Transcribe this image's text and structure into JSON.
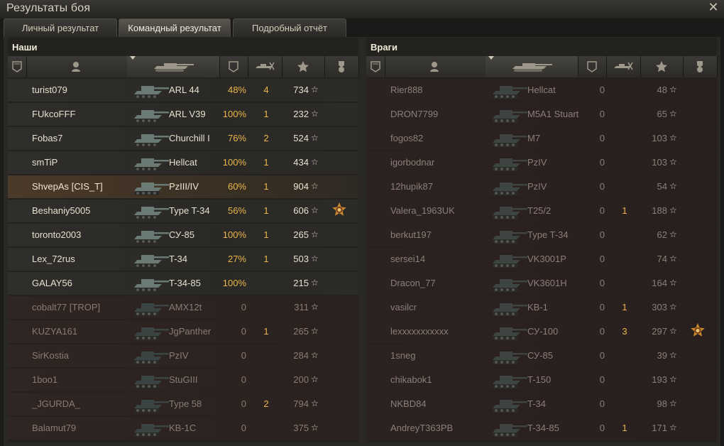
{
  "window": {
    "title": "Результаты боя",
    "close_glyph": "✕"
  },
  "tabs": [
    {
      "label": "Личный результат",
      "active": false
    },
    {
      "label": "Командный результат",
      "active": true
    },
    {
      "label": "Подробный отчёт",
      "active": false
    }
  ],
  "allies": {
    "title": "Наши",
    "columns": [
      "squad-icon",
      "player-icon",
      "vehicle-icon",
      "damage-icon",
      "kills-icon",
      "xp-star-icon",
      "medal-icon"
    ],
    "players": [
      {
        "name": "turist079",
        "vehicle": "ARL 44",
        "damage": "48%",
        "kills": "4",
        "xp": "734",
        "status": "alive",
        "medal": false
      },
      {
        "name": "FUkcoFFF",
        "vehicle": "ARL V39",
        "damage": "100%",
        "kills": "1",
        "xp": "232",
        "status": "alive",
        "medal": false
      },
      {
        "name": "Fobas7",
        "vehicle": "Churchill I",
        "damage": "76%",
        "kills": "2",
        "xp": "524",
        "status": "alive",
        "medal": false
      },
      {
        "name": "smTiP",
        "vehicle": "Hellcat",
        "damage": "100%",
        "kills": "1",
        "xp": "434",
        "status": "alive",
        "medal": false
      },
      {
        "name": "ShvepAs [CIS_T]",
        "vehicle": "PzIII/IV",
        "damage": "60%",
        "kills": "1",
        "xp": "904",
        "status": "me",
        "medal": false
      },
      {
        "name": "Beshaniy5005",
        "vehicle": "Type T-34",
        "damage": "56%",
        "kills": "1",
        "xp": "606",
        "status": "alive",
        "medal": true
      },
      {
        "name": "toronto2003",
        "vehicle": "СУ-85",
        "damage": "100%",
        "kills": "1",
        "xp": "265",
        "status": "alive",
        "medal": false
      },
      {
        "name": "Lex_72rus",
        "vehicle": "T-34",
        "damage": "27%",
        "kills": "1",
        "xp": "503",
        "status": "alive",
        "medal": false
      },
      {
        "name": "GALAY56",
        "vehicle": "T-34-85",
        "damage": "100%",
        "kills": "",
        "xp": "215",
        "status": "alive",
        "medal": false
      },
      {
        "name": "cobalt77 [TROP]",
        "vehicle": "AMX12t",
        "damage": "0",
        "kills": "",
        "xp": "311",
        "status": "dead",
        "medal": false
      },
      {
        "name": "KUZYA161",
        "vehicle": "JgPanther",
        "damage": "0",
        "kills": "1",
        "xp": "265",
        "status": "dead",
        "medal": false
      },
      {
        "name": "SirKostia",
        "vehicle": "PzIV",
        "damage": "0",
        "kills": "",
        "xp": "284",
        "status": "dead",
        "medal": false
      },
      {
        "name": "1boo1",
        "vehicle": "StuGIII",
        "damage": "0",
        "kills": "",
        "xp": "200",
        "status": "dead",
        "medal": false
      },
      {
        "name": "_JGURDA_",
        "vehicle": "Type 58",
        "damage": "0",
        "kills": "2",
        "xp": "794",
        "status": "dead",
        "medal": false
      },
      {
        "name": "Balamut79",
        "vehicle": "KB-1C",
        "damage": "0",
        "kills": "",
        "xp": "375",
        "status": "dead",
        "medal": false
      }
    ]
  },
  "enemies": {
    "title": "Враги",
    "columns": [
      "squad-icon",
      "player-icon",
      "vehicle-icon",
      "damage-icon",
      "kills-icon",
      "xp-star-icon",
      "medal-icon"
    ],
    "players": [
      {
        "name": "Rier888",
        "vehicle": "Hellcat",
        "damage": "0",
        "kills": "",
        "xp": "48",
        "medal": false
      },
      {
        "name": "DRON7799",
        "vehicle": "M5A1 Stuart",
        "damage": "0",
        "kills": "",
        "xp": "65",
        "medal": false
      },
      {
        "name": "fogos82",
        "vehicle": "M7",
        "damage": "0",
        "kills": "",
        "xp": "103",
        "medal": false
      },
      {
        "name": "igorbodnar",
        "vehicle": "PzIV",
        "damage": "0",
        "kills": "",
        "xp": "103",
        "medal": false
      },
      {
        "name": "12hupik87",
        "vehicle": "PzIV",
        "damage": "0",
        "kills": "",
        "xp": "54",
        "medal": false
      },
      {
        "name": "Valera_1963UK",
        "vehicle": "T25/2",
        "damage": "0",
        "kills": "1",
        "xp": "188",
        "medal": false
      },
      {
        "name": "berkut197",
        "vehicle": "Type T-34",
        "damage": "0",
        "kills": "",
        "xp": "62",
        "medal": false
      },
      {
        "name": "sersei14",
        "vehicle": "VK3001P",
        "damage": "0",
        "kills": "",
        "xp": "74",
        "medal": false
      },
      {
        "name": "Dracon_77",
        "vehicle": "VK3601H",
        "damage": "0",
        "kills": "",
        "xp": "164",
        "medal": false
      },
      {
        "name": "vasilcr",
        "vehicle": "KB-1",
        "damage": "0",
        "kills": "1",
        "xp": "303",
        "medal": false
      },
      {
        "name": "lexxxxxxxxxxx",
        "vehicle": "СУ-100",
        "damage": "0",
        "kills": "3",
        "xp": "297",
        "medal": true
      },
      {
        "name": "1sneg",
        "vehicle": "СУ-85",
        "damage": "0",
        "kills": "",
        "xp": "39",
        "medal": false
      },
      {
        "name": "chikabok1",
        "vehicle": "T-150",
        "damage": "0",
        "kills": "",
        "xp": "193",
        "medal": false
      },
      {
        "name": "NKBD84",
        "vehicle": "T-34",
        "damage": "0",
        "kills": "",
        "xp": "98",
        "medal": false
      },
      {
        "name": "AndreyT363PB",
        "vehicle": "T-34-85",
        "damage": "0",
        "kills": "1",
        "xp": "171",
        "medal": false
      }
    ]
  },
  "star_glyph": "☆",
  "colors": {
    "accent": "#e9b64a",
    "dead_text": "#8c7f77",
    "self_row": "#4b3a29"
  }
}
